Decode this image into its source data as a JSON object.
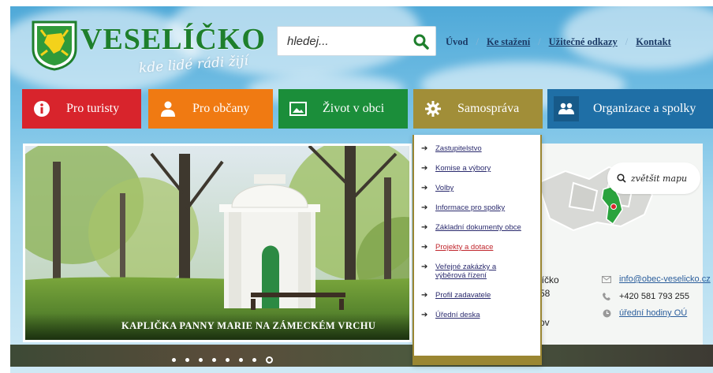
{
  "brand": {
    "name": "VESELÍČKO",
    "tagline": "kde lidé rádi žijí"
  },
  "search": {
    "placeholder": "hledej..."
  },
  "top_nav": [
    "Úvod",
    "Ke stažení",
    "Užitečné odkazy",
    "Kontakt"
  ],
  "main_nav": [
    {
      "label": "Pro turisty",
      "icon": "info-icon",
      "color": "#d8242c"
    },
    {
      "label": "Pro občany",
      "icon": "person-icon",
      "color": "#f07a12"
    },
    {
      "label": "Život v obci",
      "icon": "picture-icon",
      "color": "#1b8e3a"
    },
    {
      "label": "Samospráva",
      "icon": "gear-icon",
      "color": "#a18e38"
    },
    {
      "label": "Organizace a spolky",
      "icon": "group-icon",
      "color": "#1f6fa6"
    }
  ],
  "dropdown": {
    "items": [
      "Zastupitelstvo",
      "Komise a výbory",
      "Volby",
      "Informace pro spolky",
      "Základní dokumenty obce",
      "Projekty a dotace",
      "Veřejné zakázky a výběrová řízení",
      "Profil zadavatele",
      "Úřední deska"
    ],
    "highlighted": "Projekty a dotace"
  },
  "slider": {
    "caption": "KAPLIČKA PANNY MARIE NA ZÁMECKÉM VRCHU",
    "dots": 8,
    "active_dot": 8
  },
  "map": {
    "zoom_label": "zvětšit mapu"
  },
  "contact": {
    "email": "info@obec-veselicko.cz",
    "phone": "+420 581 793 255",
    "hours": "úřední hodiny OÚ",
    "partial": [
      "líčko",
      "58",
      "ov"
    ]
  }
}
